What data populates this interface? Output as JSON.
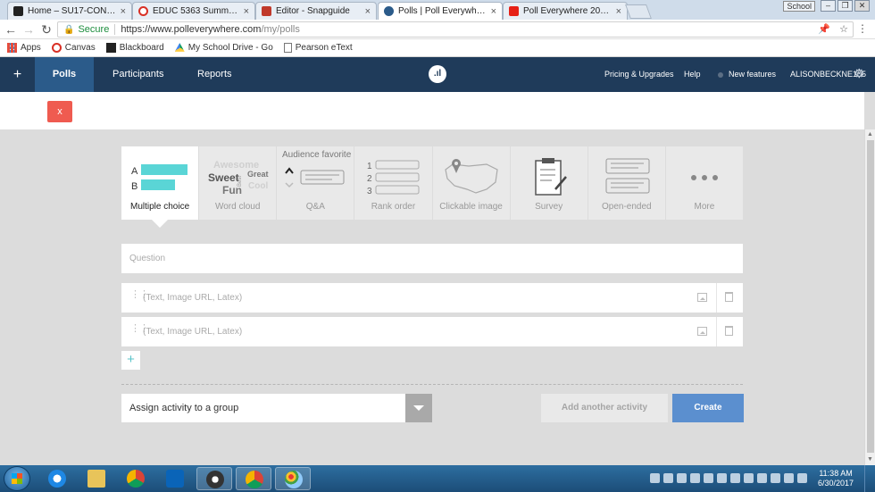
{
  "browser": {
    "tabs": [
      {
        "label": "Home – SU17-CONTEMP",
        "favicon_color": "#222222"
      },
      {
        "label": "EDUC 5363 Summer 201",
        "favicon_color": "#d93025"
      },
      {
        "label": "Editor - Snapguide",
        "favicon_color": "#c0392b"
      },
      {
        "label": "Polls | Poll Everywhere",
        "favicon_color": "#2b5b8a"
      },
      {
        "label": "Poll Everywhere 2017 Tu",
        "favicon_color": "#e62117"
      }
    ],
    "profile": "School",
    "address": {
      "secure_label": "Secure",
      "url_host": "https://www.polleverywhere.com",
      "url_path": "/my/polls"
    },
    "bookmarks": [
      "Apps",
      "Canvas",
      "Blackboard",
      "My School Drive - Go",
      "Pearson eText"
    ]
  },
  "nav": {
    "polls": "Polls",
    "participants": "Participants",
    "reports": "Reports",
    "pricing": "Pricing & Upgrades",
    "help": "Help",
    "new_features": "New features",
    "user": "ALISONBECKNE105"
  },
  "close_label": "x",
  "activity_types": [
    {
      "name": "Multiple choice",
      "active": true
    },
    {
      "name": "Word cloud",
      "active": false
    },
    {
      "name": "Q&A",
      "active": false,
      "banner": "Audience favorite"
    },
    {
      "name": "Rank order",
      "active": false
    },
    {
      "name": "Clickable image",
      "active": false
    },
    {
      "name": "Survey",
      "active": false
    },
    {
      "name": "Open-ended",
      "active": false
    },
    {
      "name": "More",
      "active": false
    }
  ],
  "mc_icon": {
    "a": "A",
    "b": "B",
    "bar_color": "#5ad5d6"
  },
  "wordcloud_icon": {
    "w1": "Awesome",
    "w2": "Sweet",
    "w3": "Great",
    "w4": "Best",
    "w5": "Fun",
    "w6": "Cool"
  },
  "rank_icon": {
    "n1": "1",
    "n2": "2",
    "n3": "3"
  },
  "question_placeholder": "Question",
  "options": [
    {
      "placeholder": "(Text, Image URL, Latex)"
    },
    {
      "placeholder": "(Text, Image URL, Latex)"
    }
  ],
  "add_option_label": "+",
  "group_select_label": "Assign activity to a group",
  "add_activity_label": "Add another activity",
  "create_label": "Create",
  "colors": {
    "nav_bg": "#1f3b5a",
    "polls_tab": "#2b5b8a",
    "close_btn": "#ef5b50",
    "create_btn": "#5b8fcf",
    "accent": "#5ac4c9"
  },
  "taskbar": {
    "time": "11:38 AM",
    "date": "6/30/2017"
  }
}
